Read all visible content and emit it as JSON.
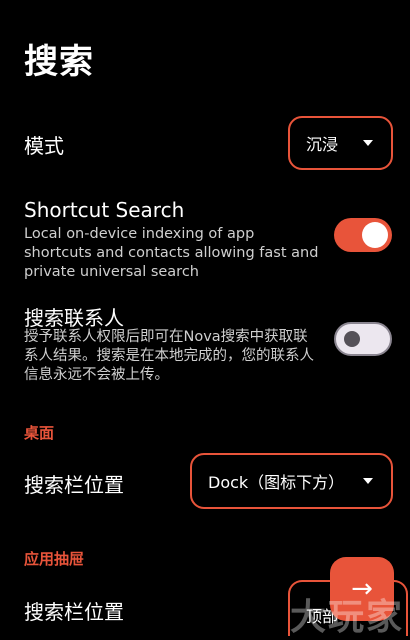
{
  "header": {
    "title": "搜索"
  },
  "mode": {
    "label": "模式",
    "value": "沉浸"
  },
  "shortcut_search": {
    "title": "Shortcut Search",
    "description": "Local on-device indexing of app shortcuts and contacts allowing fast and private universal search",
    "enabled": true
  },
  "search_contacts": {
    "title": "搜索联系人",
    "description": "授予联系人权限后即可在Nova搜索中获取联系人结果。搜索是在本地完成的，您的联系人信息永远不会被上传。",
    "enabled": false
  },
  "desktop_section": {
    "header": "桌面",
    "bar_position_label": "搜索栏位置",
    "bar_position_value": "Dock（图标下方）"
  },
  "drawer_section": {
    "header": "应用抽屉",
    "bar_position_label": "搜索栏位置",
    "bar_position_value": "顶部"
  },
  "fab": {
    "icon": "arrow-right-icon",
    "glyph": "→"
  },
  "watermark": {
    "text": "大玩家"
  },
  "colors": {
    "accent": "#e8543a",
    "background": "#000000"
  }
}
